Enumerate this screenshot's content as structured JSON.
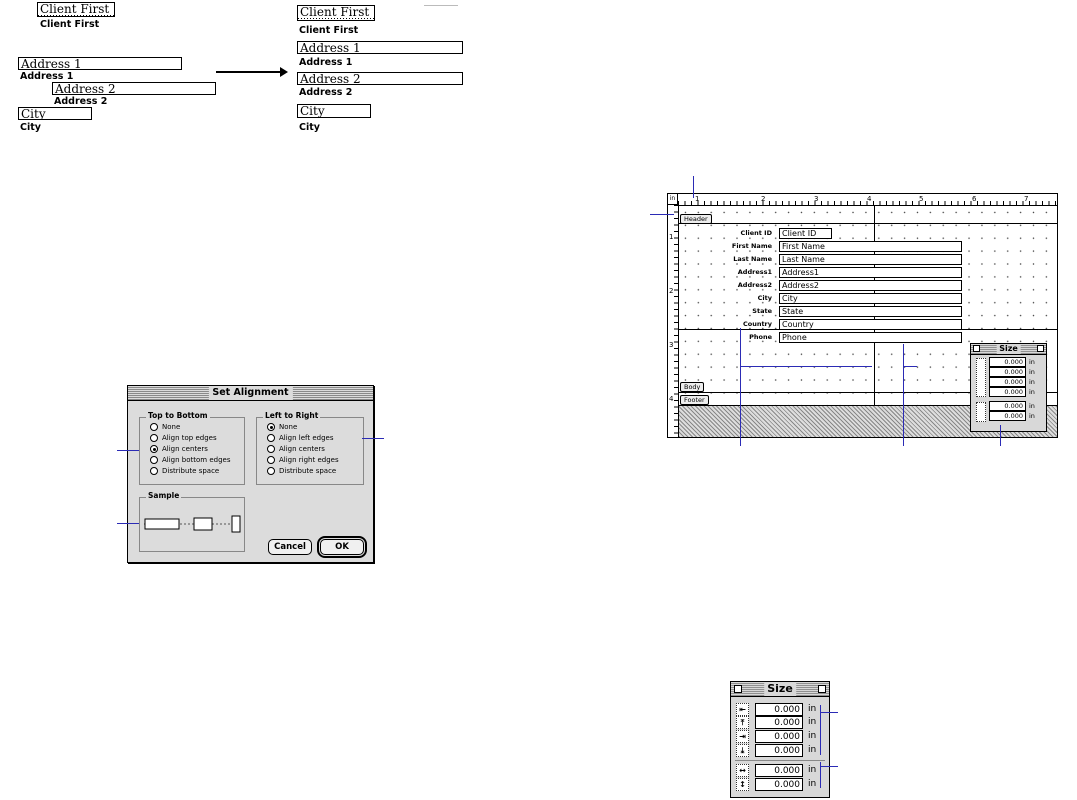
{
  "before_fields": [
    {
      "box": "Client First",
      "label": "Client First"
    },
    {
      "box": "Address 1",
      "label": "Address 1"
    },
    {
      "box": "Address 2",
      "label": "Address 2"
    },
    {
      "box": "City",
      "label": "City"
    }
  ],
  "after_fields": [
    {
      "box": "Client First",
      "label": "Client First"
    },
    {
      "box": "Address 1",
      "label": "Address 1"
    },
    {
      "box": "Address 2",
      "label": "Address 2"
    },
    {
      "box": "City",
      "label": "City"
    }
  ],
  "arrow_icon": "right-arrow-icon",
  "dialog": {
    "title": "Set Alignment",
    "top_to_bottom": {
      "title": "Top to Bottom",
      "options": [
        "None",
        "Align top edges",
        "Align centers",
        "Align bottom edges",
        "Distribute space"
      ],
      "selected": "Align centers"
    },
    "left_to_right": {
      "title": "Left to Right",
      "options": [
        "None",
        "Align left edges",
        "Align centers",
        "Align right edges",
        "Distribute space"
      ],
      "selected": "None"
    },
    "sample": {
      "title": "Sample"
    },
    "cancel_label": "Cancel",
    "ok_label": "OK"
  },
  "editor": {
    "ruler_unit": "in",
    "ruler_numbers": [
      "1",
      "2",
      "3",
      "4",
      "5",
      "6",
      "7"
    ],
    "ruler_left_numbers": [
      "1",
      "2",
      "3",
      "4"
    ],
    "parts": {
      "header": "Header",
      "body": "Body",
      "footer": "Footer"
    },
    "fields": [
      {
        "label": "Client ID",
        "value": "Client ID"
      },
      {
        "label": "First Name",
        "value": "First Name"
      },
      {
        "label": "Last Name",
        "value": "Last Name"
      },
      {
        "label": "Address1",
        "value": "Address1"
      },
      {
        "label": "Address2",
        "value": "Address2"
      },
      {
        "label": "City",
        "value": "City"
      },
      {
        "label": "State",
        "value": "State"
      },
      {
        "label": "Country",
        "value": "Country"
      },
      {
        "label": "Phone",
        "value": "Phone"
      }
    ]
  },
  "size_palette": {
    "title": "Size",
    "rows": [
      {
        "icon": "left-edge-icon",
        "value": "0.000",
        "unit": "in"
      },
      {
        "icon": "top-edge-icon",
        "value": "0.000",
        "unit": "in"
      },
      {
        "icon": "right-edge-icon",
        "value": "0.000",
        "unit": "in"
      },
      {
        "icon": "bottom-edge-icon",
        "value": "0.000",
        "unit": "in"
      },
      {
        "icon": "width-icon",
        "value": "0.000",
        "unit": "in"
      },
      {
        "icon": "height-icon",
        "value": "0.000",
        "unit": "in"
      }
    ]
  },
  "accent_color": "#2b2bb5"
}
